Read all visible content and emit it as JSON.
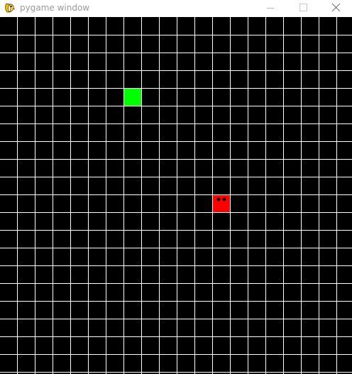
{
  "window": {
    "title": "pygame window",
    "controls": {
      "minimize": "minimize",
      "maximize": "maximize",
      "close": "close"
    },
    "icon": "pygame-snake-icon"
  },
  "game": {
    "background_color": "#000000",
    "grid_line_color": "#ffffff",
    "grid": {
      "columns": 20,
      "rows": 20
    },
    "food": {
      "color": "#00ff00",
      "cell": {
        "col": 7,
        "row": 4
      }
    },
    "snake": {
      "color": "#ff0000",
      "eye_color": "#000000",
      "segments": [
        {
          "col": 12,
          "row": 10
        }
      ]
    }
  }
}
